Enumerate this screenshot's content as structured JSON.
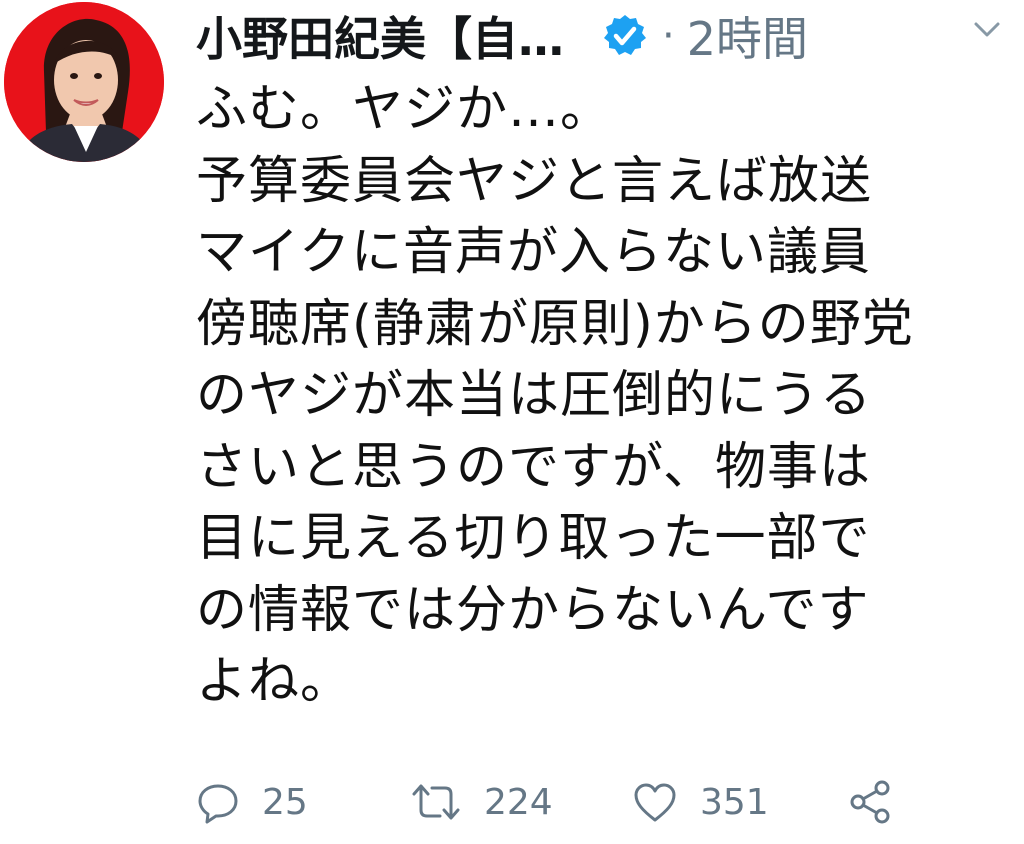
{
  "tweet": {
    "author_name": "小野田紀美【自…",
    "separator": "·",
    "time": "2時間",
    "lines": [
      "ふむ。ヤジか…。",
      "予算委員会ヤジと言えば放送",
      "マイクに音声が入らない議員",
      "傍聴席(静粛が原則)からの野党",
      "のヤジが本当は圧倒的にうる",
      "さいと思うのですが、物事は",
      "目に見える切り取った一部で",
      "の情報では分からないんです",
      "よね。"
    ]
  },
  "actions": {
    "reply_count": "25",
    "retweet_count": "224",
    "like_count": "351"
  },
  "icons": {
    "verified": "verified-badge-icon",
    "caret": "chevron-down-icon",
    "reply": "reply-icon",
    "retweet": "retweet-icon",
    "like": "heart-icon",
    "share": "share-icon"
  },
  "colors": {
    "avatar_bg": "#e8121a",
    "verified": "#1da1f2",
    "muted": "#657786",
    "text": "#111111"
  }
}
